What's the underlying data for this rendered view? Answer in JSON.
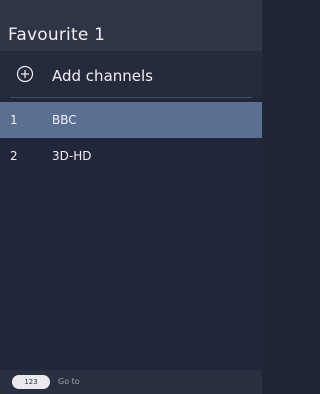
{
  "header": {
    "title": "Favourite 1"
  },
  "add_row": {
    "label": "Add channels",
    "icon": "add-circle-icon"
  },
  "channels": [
    {
      "number": "1",
      "name": "BBC",
      "selected": true
    },
    {
      "number": "2",
      "name": "3D-HD",
      "selected": false
    }
  ],
  "footer": {
    "badge": "123",
    "hint": "Go to"
  },
  "colors": {
    "background": "#21263a",
    "header": "#2f3547",
    "selected_row": "#5b6f92",
    "text": "#eef0f4",
    "hint_text": "#9aa1b2"
  }
}
